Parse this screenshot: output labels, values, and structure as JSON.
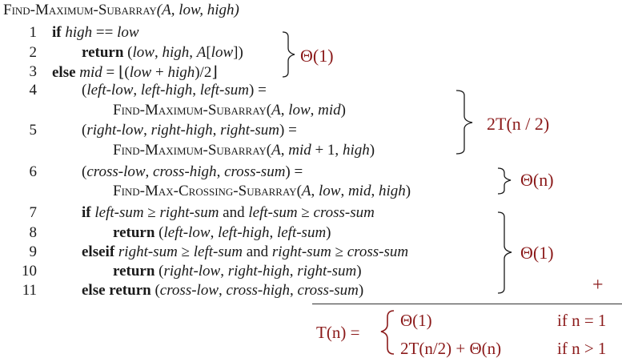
{
  "title": {
    "proc_name": "Find-Maximum-Subarray",
    "args": "(A, low, high)"
  },
  "lines": [
    {
      "num": "1",
      "parts": [
        {
          "t": "if ",
          "s": "b"
        },
        {
          "t": "high",
          "s": "it"
        },
        {
          "t": " == ",
          "s": ""
        },
        {
          "t": "low",
          "s": "it"
        }
      ]
    },
    {
      "num": "2",
      "parts": [
        {
          "t": "return ",
          "s": "b"
        },
        {
          "t": "(",
          "s": ""
        },
        {
          "t": "low",
          "s": "it"
        },
        {
          "t": ", ",
          "s": ""
        },
        {
          "t": "high",
          "s": "it"
        },
        {
          "t": ", ",
          "s": ""
        },
        {
          "t": "A",
          "s": "it"
        },
        {
          "t": "[",
          "s": ""
        },
        {
          "t": "low",
          "s": "it"
        },
        {
          "t": "])",
          "s": ""
        }
      ]
    },
    {
      "num": "3",
      "parts": [
        {
          "t": "else ",
          "s": "b"
        },
        {
          "t": "mid",
          "s": "it"
        },
        {
          "t": " = ⌊(",
          "s": ""
        },
        {
          "t": "low",
          "s": "it"
        },
        {
          "t": " + ",
          "s": ""
        },
        {
          "t": "high",
          "s": "it"
        },
        {
          "t": ")/2⌋",
          "s": ""
        }
      ]
    },
    {
      "num": "4",
      "parts": [
        {
          "t": "(",
          "s": ""
        },
        {
          "t": "left-low",
          "s": "it"
        },
        {
          "t": ", ",
          "s": ""
        },
        {
          "t": "left-high",
          "s": "it"
        },
        {
          "t": ", ",
          "s": ""
        },
        {
          "t": "left-sum",
          "s": "it"
        },
        {
          "t": ") =",
          "s": ""
        }
      ]
    },
    {
      "num": "",
      "parts": [
        {
          "t": "Find-Maximum-Subarray",
          "s": "sc"
        },
        {
          "t": "(",
          "s": ""
        },
        {
          "t": "A",
          "s": "it"
        },
        {
          "t": ", ",
          "s": ""
        },
        {
          "t": "low",
          "s": "it"
        },
        {
          "t": ", ",
          "s": ""
        },
        {
          "t": "mid",
          "s": "it"
        },
        {
          "t": ")",
          "s": ""
        }
      ]
    },
    {
      "num": "5",
      "parts": [
        {
          "t": "(",
          "s": ""
        },
        {
          "t": "right-low",
          "s": "it"
        },
        {
          "t": ", ",
          "s": ""
        },
        {
          "t": "right-high",
          "s": "it"
        },
        {
          "t": ", ",
          "s": ""
        },
        {
          "t": "right-sum",
          "s": "it"
        },
        {
          "t": ") =",
          "s": ""
        }
      ]
    },
    {
      "num": "",
      "parts": [
        {
          "t": "Find-Maximum-Subarray",
          "s": "sc"
        },
        {
          "t": "(",
          "s": ""
        },
        {
          "t": "A",
          "s": "it"
        },
        {
          "t": ", ",
          "s": ""
        },
        {
          "t": "mid",
          "s": "it"
        },
        {
          "t": " + 1, ",
          "s": ""
        },
        {
          "t": "high",
          "s": "it"
        },
        {
          "t": ")",
          "s": ""
        }
      ]
    },
    {
      "num": "6",
      "parts": [
        {
          "t": "(",
          "s": ""
        },
        {
          "t": "cross-low",
          "s": "it"
        },
        {
          "t": ", ",
          "s": ""
        },
        {
          "t": "cross-high",
          "s": "it"
        },
        {
          "t": ", ",
          "s": ""
        },
        {
          "t": "cross-sum",
          "s": "it"
        },
        {
          "t": ") =",
          "s": ""
        }
      ]
    },
    {
      "num": "",
      "parts": [
        {
          "t": "Find-Max-Crossing-Subarray",
          "s": "sc"
        },
        {
          "t": "(",
          "s": ""
        },
        {
          "t": "A",
          "s": "it"
        },
        {
          "t": ", ",
          "s": ""
        },
        {
          "t": "low",
          "s": "it"
        },
        {
          "t": ", ",
          "s": ""
        },
        {
          "t": "mid",
          "s": "it"
        },
        {
          "t": ", ",
          "s": ""
        },
        {
          "t": "high",
          "s": "it"
        },
        {
          "t": ")",
          "s": ""
        }
      ]
    },
    {
      "num": "7",
      "parts": [
        {
          "t": "if ",
          "s": "b"
        },
        {
          "t": "left-sum",
          "s": "it"
        },
        {
          "t": " ≥ ",
          "s": ""
        },
        {
          "t": "right-sum",
          "s": "it"
        },
        {
          "t": " and ",
          "s": ""
        },
        {
          "t": "left-sum",
          "s": "it"
        },
        {
          "t": " ≥ ",
          "s": ""
        },
        {
          "t": "cross-sum",
          "s": "it"
        }
      ]
    },
    {
      "num": "8",
      "parts": [
        {
          "t": "return ",
          "s": "b"
        },
        {
          "t": "(",
          "s": ""
        },
        {
          "t": "left-low",
          "s": "it"
        },
        {
          "t": ", ",
          "s": ""
        },
        {
          "t": "left-high",
          "s": "it"
        },
        {
          "t": ", ",
          "s": ""
        },
        {
          "t": "left-sum",
          "s": "it"
        },
        {
          "t": ")",
          "s": ""
        }
      ]
    },
    {
      "num": "9",
      "parts": [
        {
          "t": "elseif ",
          "s": "b"
        },
        {
          "t": "right-sum",
          "s": "it"
        },
        {
          "t": " ≥ ",
          "s": ""
        },
        {
          "t": "left-sum",
          "s": "it"
        },
        {
          "t": " and ",
          "s": ""
        },
        {
          "t": "right-sum",
          "s": "it"
        },
        {
          "t": " ≥ ",
          "s": ""
        },
        {
          "t": "cross-sum",
          "s": "it"
        }
      ]
    },
    {
      "num": "10",
      "parts": [
        {
          "t": "return ",
          "s": "b"
        },
        {
          "t": "(",
          "s": ""
        },
        {
          "t": "right-low",
          "s": "it"
        },
        {
          "t": ", ",
          "s": ""
        },
        {
          "t": "right-high",
          "s": "it"
        },
        {
          "t": ", ",
          "s": ""
        },
        {
          "t": "right-sum",
          "s": "it"
        },
        {
          "t": ")",
          "s": ""
        }
      ]
    },
    {
      "num": "11",
      "parts": [
        {
          "t": "else return ",
          "s": "b"
        },
        {
          "t": "(",
          "s": ""
        },
        {
          "t": "cross-low",
          "s": "it"
        },
        {
          "t": ", ",
          "s": ""
        },
        {
          "t": "cross-high",
          "s": "it"
        },
        {
          "t": ", ",
          "s": ""
        },
        {
          "t": "cross-sum",
          "s": "it"
        },
        {
          "t": ")",
          "s": ""
        }
      ]
    }
  ],
  "annotations": {
    "theta_1_top": "Θ(1)",
    "two_t_n_half": "2T(n / 2)",
    "theta_n": "Θ(n)",
    "theta_1_bottom": "Θ(1)",
    "plus": "+"
  },
  "recurrence": {
    "lhs": "T(n) =",
    "case1_value": "Θ(1)",
    "case1_cond": "if n = 1",
    "case2_value": "2T(n/2) + Θ(n)",
    "case2_cond": "if n > 1"
  },
  "colors": {
    "annotation": "#8b1a1a",
    "text": "#1a1a1a"
  }
}
